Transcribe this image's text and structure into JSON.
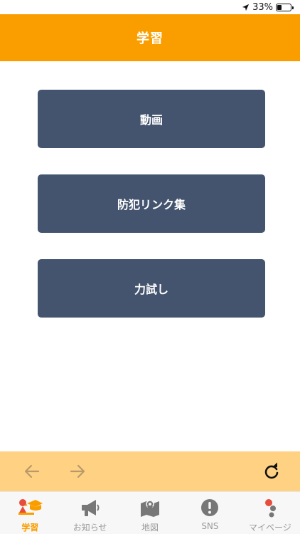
{
  "status": {
    "battery_text": "33%",
    "battery_level": 0.33
  },
  "header": {
    "title": "学習"
  },
  "menu": [
    {
      "label": "動画"
    },
    {
      "label": "防犯リンク集"
    },
    {
      "label": "力試し"
    }
  ],
  "browser_nav": {
    "back_icon": "arrow-left-icon",
    "forward_icon": "arrow-right-icon",
    "reload_icon": "reload-icon"
  },
  "tabs": [
    {
      "label": "学習",
      "icon": "graduation-cap-icon",
      "active": true
    },
    {
      "label": "お知らせ",
      "icon": "megaphone-icon",
      "active": false
    },
    {
      "label": "地図",
      "icon": "map-icon",
      "active": false
    },
    {
      "label": "SNS",
      "icon": "alert-circle-icon",
      "active": false
    },
    {
      "label": "マイページ",
      "icon": "user-icon",
      "active": false
    }
  ],
  "colors": {
    "accent": "#fa9e00",
    "button": "#44546e",
    "browser_bar": "#ffd183",
    "inactive_tab": "#9a9a9a"
  }
}
